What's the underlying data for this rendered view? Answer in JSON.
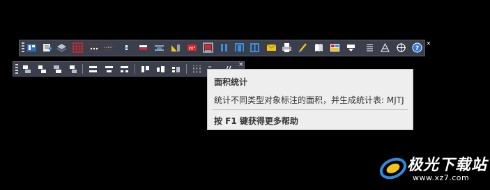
{
  "toolbar_main": {
    "icons": [
      "building-props-icon",
      "document-edit-icon",
      "layers-stack-icon",
      "grid-table-icon",
      "dotted-grid-icon",
      "dotted-lines-icon",
      "column-icon",
      "wall-icon",
      "beam-icon",
      "dimension-icon",
      "area-m2-icon",
      "area-statistics-icon",
      "pillar-pair-icon",
      "door-frame-icon",
      "window-frame-icon",
      "envelope-icon",
      "printer-icon",
      "pen-icon",
      "book-icon",
      "color-table-icon",
      "download-icon",
      "list-lines-icon",
      "triangle-level-icon",
      "crosshair-icon",
      "help-icon"
    ],
    "close_label": "×"
  },
  "toolbar_secondary": {
    "icons": [
      "align-stack-1-icon",
      "align-stack-2-icon",
      "align-stack-3-icon",
      "align-stack-4-icon",
      "distribute-h-1-icon",
      "distribute-h-2-icon",
      "distribute-h-3-icon",
      "align-top-1-icon",
      "align-top-2-icon",
      "align-top-3-icon",
      "equal-spacing-icon",
      "equal-size-icon",
      "slash-icon"
    ],
    "close_label": "×"
  },
  "tooltip": {
    "title": "面积统计",
    "description": "统计不同类型对象标注的面积，并生成统计表: MJTJ",
    "help": "按 F1 键获得更多帮助"
  },
  "watermark": {
    "text": "极光下载站",
    "url": "www.xz7.com"
  },
  "colors": {
    "background": "#000000",
    "toolbar": "#3a3f4b",
    "tooltip_bg": "#eeeeee",
    "accent_red": "#d9262c",
    "accent_blue": "#3a8de0",
    "accent_yellow": "#f0c419"
  }
}
